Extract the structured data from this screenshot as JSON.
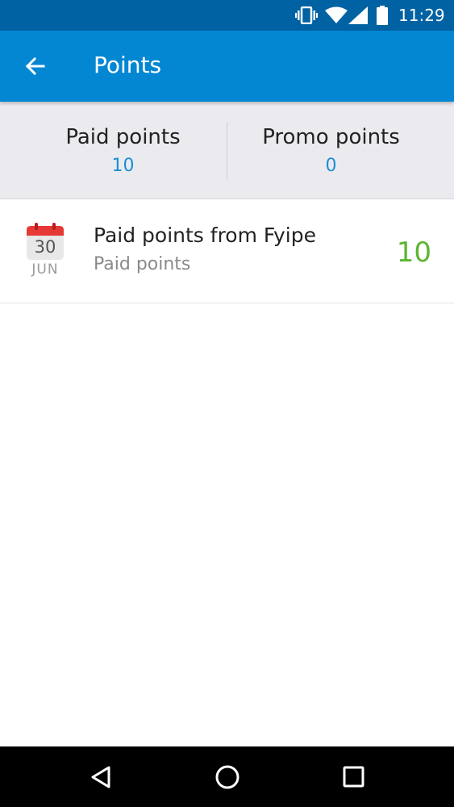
{
  "status_bar": {
    "time": "11:29",
    "icons": [
      "vibrate-icon",
      "wifi-icon",
      "signal-icon",
      "battery-icon"
    ],
    "color": "#0062a3"
  },
  "app_bar": {
    "title": "Points",
    "back_icon": "arrow-back-icon",
    "color": "#0387d3"
  },
  "summary": {
    "paid": {
      "label": "Paid points",
      "value": "10"
    },
    "promo": {
      "label": "Promo points",
      "value": "0"
    },
    "value_color": "#1a8fd6"
  },
  "transactions": [
    {
      "day": "30",
      "month": "JUN",
      "title": "Paid points from Fyipe",
      "subtitle": "Paid points",
      "amount": "10",
      "amount_color": "#5cb531",
      "icon": "calendar-icon"
    }
  ],
  "nav_bar": {
    "buttons": [
      "back-triangle-icon",
      "home-circle-icon",
      "recents-square-icon"
    ]
  }
}
